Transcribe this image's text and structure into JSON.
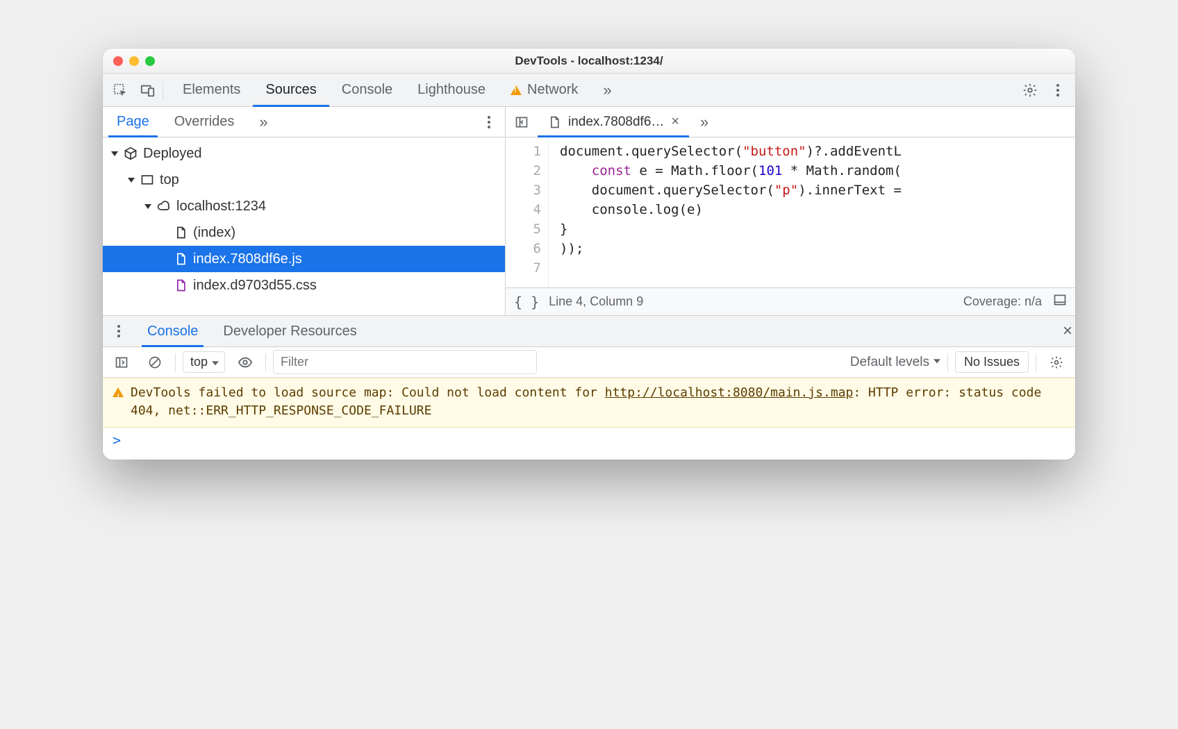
{
  "window": {
    "title": "DevTools - localhost:1234/"
  },
  "mainTabs": {
    "elements": "Elements",
    "sources": "Sources",
    "console": "Console",
    "lighthouse": "Lighthouse",
    "network": "Network"
  },
  "leftTabs": {
    "page": "Page",
    "overrides": "Overrides"
  },
  "tree": {
    "deployed": "Deployed",
    "top": "top",
    "host": "localhost:1234",
    "index": "(index)",
    "jsFile": "index.7808df6e.js",
    "cssFile": "index.d9703d55.css"
  },
  "editorTab": "index.7808df6…",
  "code": {
    "l1_a": "document.querySelector(",
    "l1_b": "\"button\"",
    "l1_c": ")?.addEventL",
    "l2_a": "    ",
    "l2_kw": "const",
    "l2_b": " e = Math.floor(",
    "l2_num": "101",
    "l2_c": " * Math.random(",
    "l3_a": "    document.querySelector(",
    "l3_b": "\"p\"",
    "l3_c": ").innerText =",
    "l4": "    console.log(e)",
    "l5": "}",
    "l6": "));",
    "l7": ""
  },
  "gutter": [
    "1",
    "2",
    "3",
    "4",
    "5",
    "6",
    "7"
  ],
  "status": {
    "pos": "Line 4, Column 9",
    "coverage": "Coverage: n/a"
  },
  "drawer": {
    "console": "Console",
    "devres": "Developer Resources"
  },
  "consoleToolbar": {
    "context": "top",
    "filterPlaceholder": "Filter",
    "levels": "Default levels",
    "noIssues": "No Issues"
  },
  "consoleWarn": {
    "prefix": "DevTools failed to load source map: Could not load content for ",
    "url": "http://localhost:8080/main.js.map",
    "suffix": ": HTTP error: status code 404, net::ERR_HTTP_RESPONSE_CODE_FAILURE"
  },
  "prompt": ">"
}
